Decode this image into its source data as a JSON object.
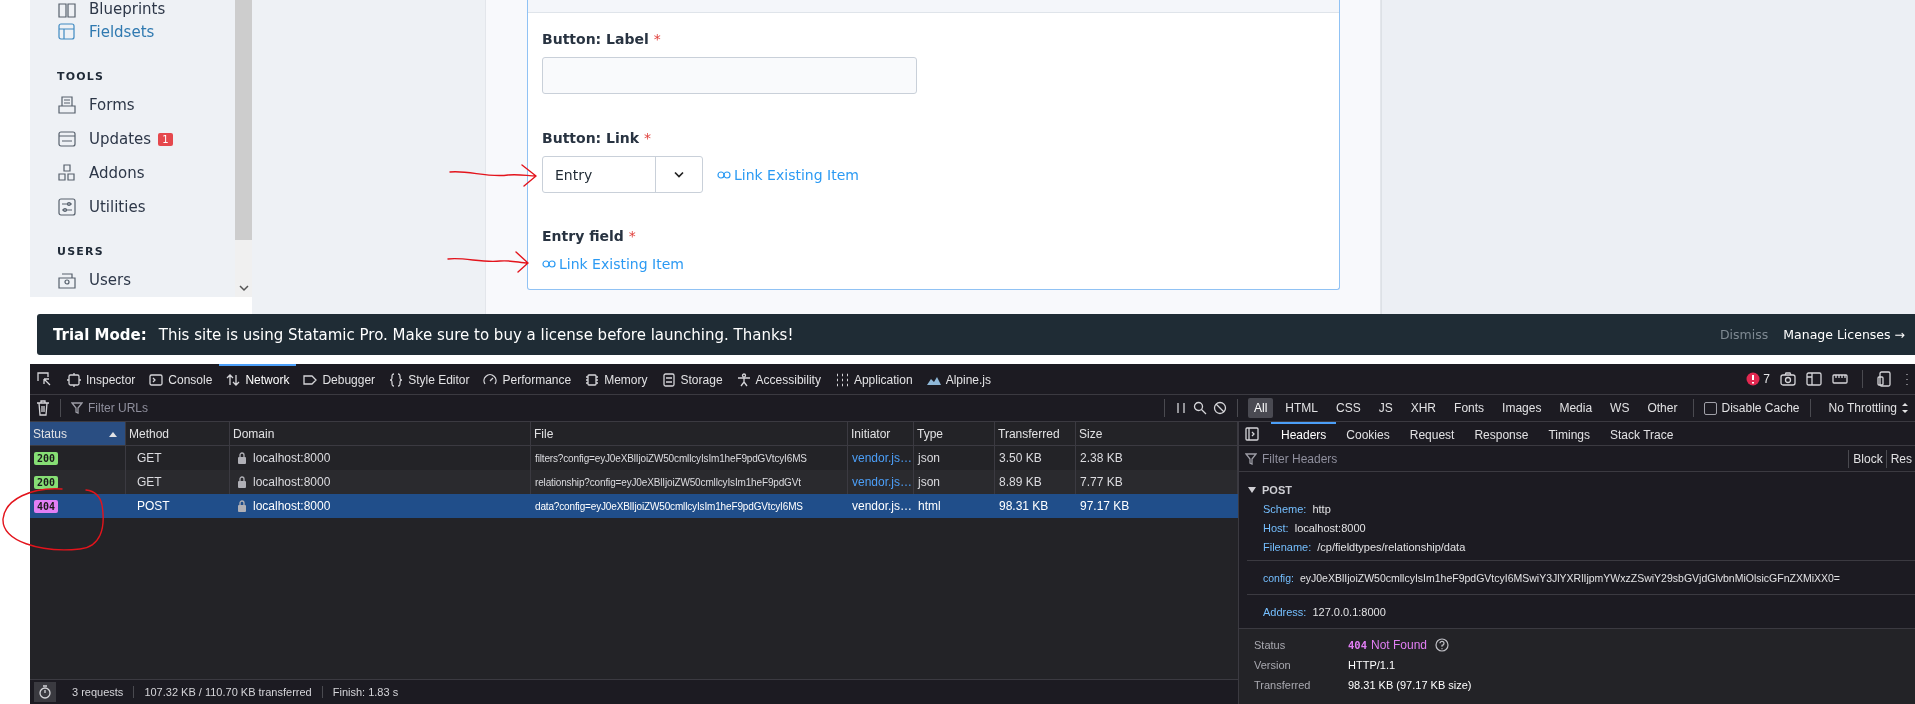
{
  "sidebar": {
    "items": [
      {
        "kind": "item",
        "label": "Blueprints",
        "selected": false
      },
      {
        "kind": "item",
        "label": "Fieldsets",
        "selected": true
      },
      {
        "kind": "heading",
        "label": "TOOLS"
      },
      {
        "kind": "item",
        "label": "Forms",
        "selected": false
      },
      {
        "kind": "item",
        "label": "Updates",
        "selected": false,
        "badge": "1"
      },
      {
        "kind": "item",
        "label": "Addons",
        "selected": false
      },
      {
        "kind": "item",
        "label": "Utilities",
        "selected": false
      },
      {
        "kind": "heading",
        "label": "USERS"
      },
      {
        "kind": "item",
        "label": "Users",
        "selected": false
      }
    ]
  },
  "form": {
    "required_mark": "*",
    "fields": [
      {
        "kind": "text",
        "label": "Button: Label",
        "required": true
      },
      {
        "kind": "select",
        "label": "Button: Link",
        "required": true,
        "value": "Entry",
        "link": "Link Existing Item"
      },
      {
        "kind": "relationship",
        "label": "Entry field",
        "required": true,
        "link": "Link Existing Item"
      }
    ]
  },
  "annotations": [
    {
      "kind": "arrow"
    },
    {
      "kind": "arrow"
    },
    {
      "kind": "circle"
    }
  ],
  "trial_bar": {
    "title": "Trial Mode:",
    "message": "This site is using Statamic Pro. Make sure to buy a license before launching. Thanks!",
    "dismiss": "Dismiss",
    "manage": "Manage Licenses →"
  },
  "devtools": {
    "tabs": [
      {
        "label": "Inspector",
        "selected": false
      },
      {
        "label": "Console",
        "selected": false
      },
      {
        "label": "Network",
        "selected": true
      },
      {
        "label": "Debugger",
        "selected": false
      },
      {
        "label": "Style Editor",
        "selected": false
      },
      {
        "label": "Performance",
        "selected": false
      },
      {
        "label": "Memory",
        "selected": false
      },
      {
        "label": "Storage",
        "selected": false
      },
      {
        "label": "Accessibility",
        "selected": false
      },
      {
        "label": "Application",
        "selected": false
      },
      {
        "label": "Alpine.js",
        "selected": false
      }
    ],
    "error_count": "7",
    "filter_placeholder": "Filter URLs",
    "type_filters": [
      {
        "label": "All",
        "selected": true
      },
      {
        "label": "HTML",
        "selected": false
      },
      {
        "label": "CSS",
        "selected": false
      },
      {
        "label": "JS",
        "selected": false
      },
      {
        "label": "XHR",
        "selected": false
      },
      {
        "label": "Fonts",
        "selected": false
      },
      {
        "label": "Images",
        "selected": false
      },
      {
        "label": "Media",
        "selected": false
      },
      {
        "label": "WS",
        "selected": false
      },
      {
        "label": "Other",
        "selected": false
      }
    ],
    "disable_cache": {
      "label": "Disable Cache",
      "checked": false
    },
    "throttling": "No Throttling",
    "columns": [
      {
        "label": "Status",
        "sorted": true
      },
      {
        "label": "Method",
        "sorted": false
      },
      {
        "label": "Domain",
        "sorted": false
      },
      {
        "label": "File",
        "sorted": false
      },
      {
        "label": "Initiator",
        "sorted": false
      },
      {
        "label": "Type",
        "sorted": false
      },
      {
        "label": "Transferred",
        "sorted": false
      },
      {
        "label": "Size",
        "sorted": false
      }
    ],
    "rows": [
      {
        "status": "200",
        "color": "#86de74",
        "method": "GET",
        "domain": "localhost:8000",
        "file": "filters?config=eyJ0eXBlIjoiZW50cmllcyIsIm1heF9pdGVtcyI6MS",
        "initiator": "vendor.js…",
        "type": "json",
        "transferred": "3.50 KB",
        "size": "2.38 KB",
        "selected": false
      },
      {
        "status": "200",
        "color": "#86de74",
        "method": "GET",
        "domain": "localhost:8000",
        "file": "relationship?config=eyJ0eXBlIjoiZW50cmllcyIsIm1heF9pdGVt",
        "initiator": "vendor.js…",
        "type": "json",
        "transferred": "8.89 KB",
        "size": "7.77 KB",
        "selected": false
      },
      {
        "status": "404",
        "color": "#e27ff5",
        "method": "POST",
        "domain": "localhost:8000",
        "file": "data?config=eyJ0eXBlIjoiZW50cmllcyIsIm1heF9pdGVtcyI6MS",
        "initiator": "vendor.js…",
        "type": "html",
        "transferred": "98.31 KB",
        "size": "97.17 KB",
        "selected": true
      }
    ],
    "details": {
      "tabs": [
        {
          "label": "Headers",
          "selected": true
        },
        {
          "label": "Cookies",
          "selected": false
        },
        {
          "label": "Request",
          "selected": false
        },
        {
          "label": "Response",
          "selected": false
        },
        {
          "label": "Timings",
          "selected": false
        },
        {
          "label": "Stack Trace",
          "selected": false
        }
      ],
      "filter_placeholder": "Filter Headers",
      "actions": [
        "Block",
        "Res"
      ],
      "request": {
        "method": "POST",
        "expanded": true,
        "fields": [
          {
            "name": "Scheme:",
            "value": "http"
          },
          {
            "name": "Host:",
            "value": "localhost:8000"
          },
          {
            "name": "Filename:",
            "value": "/cp/fieldtypes/relationship/data"
          }
        ]
      },
      "params": [
        {
          "name": "config:",
          "value": "eyJ0eXBlIjoiZW50cmllcyIsIm1heF9pdGVtcyI6MSwiY3JlYXRlIjpmYWxzZSwiY29sbGVjdGlvbnMiOlsicGFnZXMiXX0="
        }
      ],
      "remote": [
        {
          "name": "Address:",
          "value": "127.0.0.1:8000"
        }
      ],
      "summary": [
        {
          "kind": "status",
          "label": "Status",
          "code": "404",
          "value": "Not Found"
        },
        {
          "kind": "plain",
          "label": "Version",
          "value": "HTTP/1.1"
        },
        {
          "kind": "plain",
          "label": "Transferred",
          "value": "98.31 KB (97.17 KB size)"
        }
      ]
    },
    "status_bar": {
      "requests": "3 requests",
      "transferred": "107.32 KB / 110.70 KB transferred",
      "finish": "Finish: 1.83 s"
    }
  }
}
